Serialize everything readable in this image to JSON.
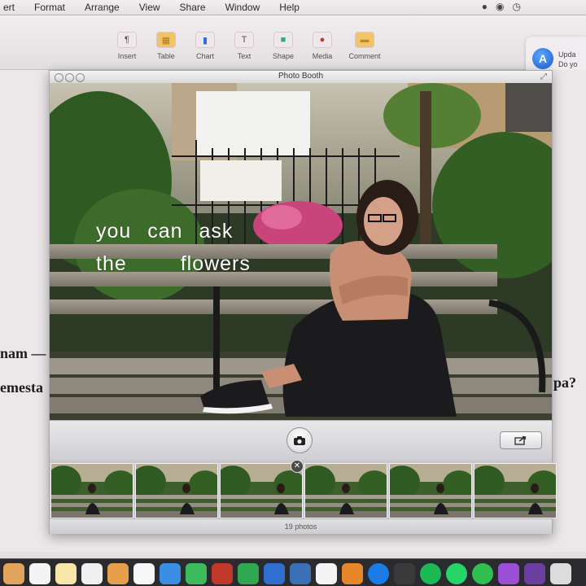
{
  "menubar": {
    "items": [
      "ert",
      "Format",
      "Arrange",
      "View",
      "Share",
      "Window",
      "Help"
    ]
  },
  "toolbar": {
    "tools": [
      {
        "label": "Insert",
        "icon": "insert-icon",
        "glyph": "¶"
      },
      {
        "label": "Table",
        "icon": "table-icon",
        "glyph": "▦"
      },
      {
        "label": "Chart",
        "icon": "chart-icon",
        "glyph": "▮"
      },
      {
        "label": "Text",
        "icon": "text-icon",
        "glyph": "T"
      },
      {
        "label": "Shape",
        "icon": "shape-icon",
        "glyph": "■"
      },
      {
        "label": "Media",
        "icon": "media-icon",
        "glyph": "●"
      },
      {
        "label": "Comment",
        "icon": "comment-icon",
        "glyph": "▬"
      }
    ]
  },
  "notification": {
    "line1": "Upda",
    "line2": "Do yo",
    "icon": "app-store-icon"
  },
  "document": {
    "frag1": "nam —",
    "frag2": "emesta",
    "frag3": "pa?"
  },
  "photobooth": {
    "title": "Photo Booth",
    "overlay_line1": "you can ask",
    "overlay_line2": "the flowers",
    "status": "19 photos",
    "thumbnail_count": 6
  },
  "colors": {
    "accent": "#1a5fd0",
    "window_chrome": "#dcdcde",
    "dock": "#2a2a2f"
  },
  "dock": {
    "icons": [
      "preview-icon",
      "calendar-icon",
      "notes-icon",
      "reminders-icon",
      "pages-icon",
      "photos-icon",
      "safari-icon",
      "facetime-icon",
      "photo-booth-icon",
      "numbers-icon",
      "keynote-icon",
      "preview-image-icon",
      "music-icon",
      "books-icon",
      "app-store-icon",
      "activity-monitor-icon",
      "spotify-icon",
      "whatsapp-icon",
      "messages-icon",
      "camera-icon",
      "imovie-icon",
      "folder-icon"
    ]
  }
}
